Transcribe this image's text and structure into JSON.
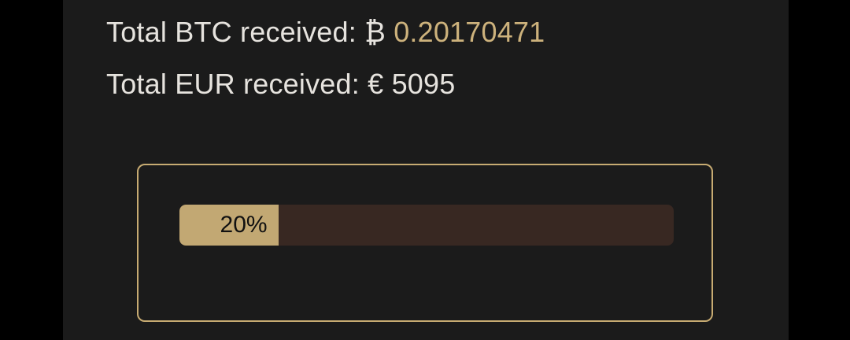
{
  "stats": {
    "btc_label": "Total BTC received: ",
    "btc_symbol": "₿",
    "btc_value": "0.20170471",
    "eur_label": "Total EUR received: ",
    "eur_symbol": "€",
    "eur_value": "5095"
  },
  "progress": {
    "percent": 20,
    "label": "20%"
  },
  "colors": {
    "background": "#1b1b1b",
    "accent_gold": "#c7ab72",
    "track": "#382822",
    "text": "#e6e3de"
  }
}
